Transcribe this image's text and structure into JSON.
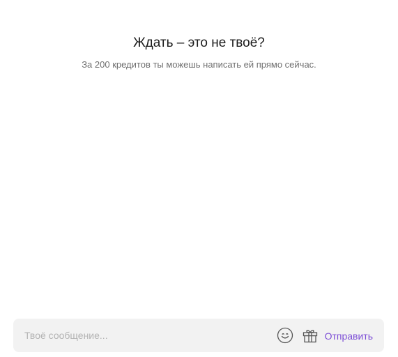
{
  "promo": {
    "title": "Ждать – это не твоё?",
    "subtitle": "За 200 кредитов ты можешь написать ей прямо сейчас."
  },
  "composer": {
    "placeholder": "Твоё сообщение...",
    "value": "",
    "emoji_icon": "smiley-face-icon",
    "gift_icon": "gift-box-icon",
    "send_label": "Отправить"
  },
  "colors": {
    "accent": "#7d4fd6",
    "composer_bg": "#f2f2f2",
    "title": "#1b1b1b",
    "subtitle": "#6f6f6f"
  }
}
